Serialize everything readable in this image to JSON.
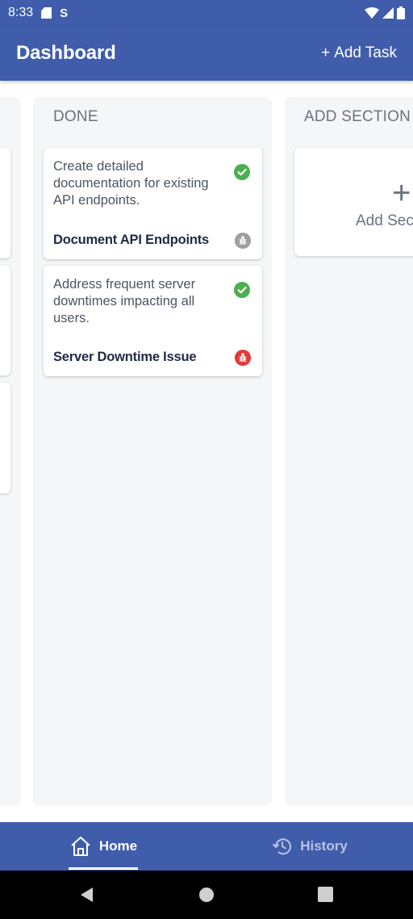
{
  "status_bar": {
    "time": "8:33"
  },
  "app_bar": {
    "title": "Dashboard",
    "add_task_label": "Add Task",
    "add_task_symbol": "+"
  },
  "columns": [
    {
      "header": "DONE",
      "cards": [
        {
          "description": "Create detailed documentation for existing API endpoints.",
          "title": "Document API Endpoints",
          "status": "done",
          "priority_color": "#9e9e9e"
        },
        {
          "description": "Address frequent server downtimes impacting all users.",
          "title": "Server Downtime Issue",
          "status": "done",
          "priority_color": "#e53935"
        }
      ]
    }
  ],
  "add_section": {
    "header": "ADD SECTION",
    "label": "Add Section",
    "symbol": "+"
  },
  "bottom_nav": {
    "items": [
      {
        "label": "Home",
        "icon": "home-icon",
        "active": true
      },
      {
        "label": "History",
        "icon": "history-icon",
        "active": false
      }
    ]
  },
  "colors": {
    "primary": "#3f5dab",
    "check": "#4caf50"
  }
}
